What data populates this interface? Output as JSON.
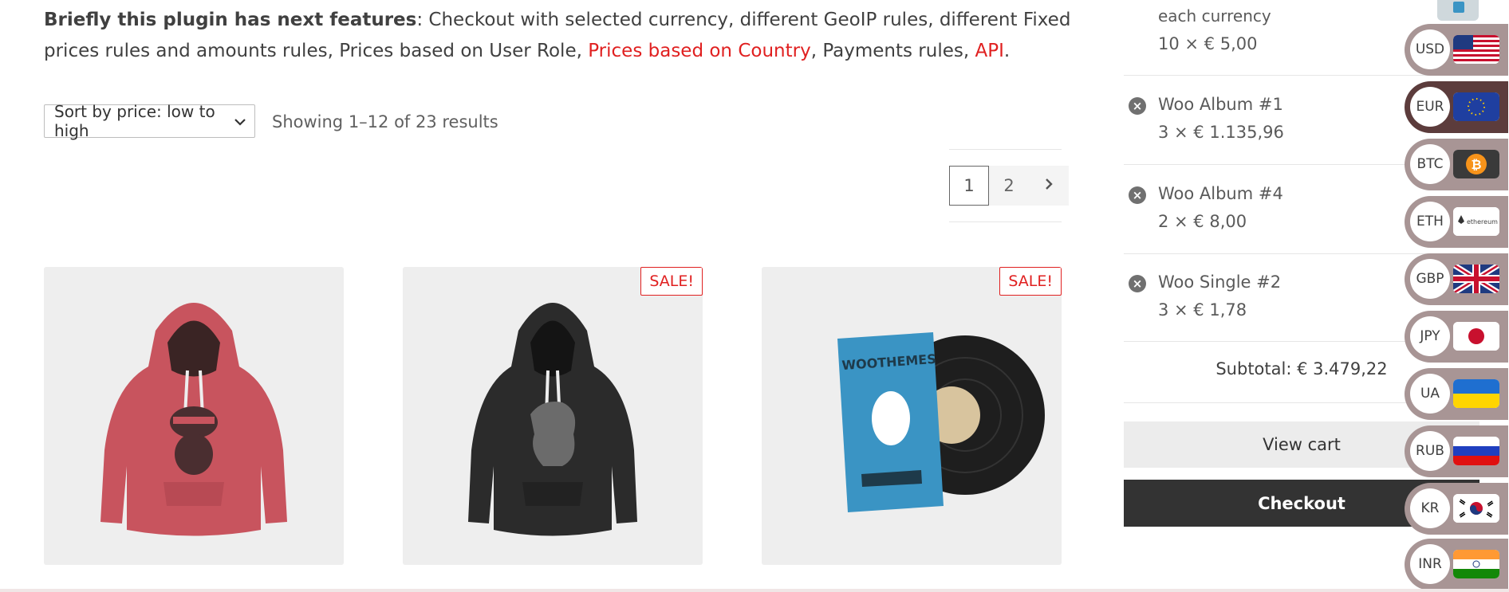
{
  "intro": {
    "lead": "Briefly this plugin has next features",
    "text1": ": Checkout with selected currency, different GeoIP rules, different Fixed prices rules and amounts rules, Prices based on User Role, ",
    "link1": "Prices based on Country",
    "text2": ", Payments rules, ",
    "link2": "API",
    "text3": "."
  },
  "shop": {
    "sort_label": "Sort by price: low to high",
    "result_count": "Showing 1–12 of 23 results",
    "pages": [
      "1",
      "2"
    ],
    "next_icon": "chevron-right-icon",
    "products": [
      {
        "name": "ninja-hoodie",
        "sale": ""
      },
      {
        "name": "black-hoodie",
        "sale": "SALE!"
      },
      {
        "name": "vinyl-album",
        "sale": "SALE!"
      }
    ]
  },
  "cart": {
    "partial_line1": "each currency",
    "partial_line2": "10 × € 5,00",
    "items": [
      {
        "name": "Woo Album #1",
        "qty": "3 × € 1.135,96"
      },
      {
        "name": "Woo Album #4",
        "qty": "2 × € 8,00"
      },
      {
        "name": "Woo Single #2",
        "qty": "3 × € 1,78"
      }
    ],
    "subtotal": "Subtotal: € 3.479,22",
    "view_cart": "View cart",
    "checkout": "Checkout"
  },
  "currencies": [
    {
      "code": "USD",
      "flag": "us-flag"
    },
    {
      "code": "EUR",
      "flag": "eu-flag",
      "active": true
    },
    {
      "code": "BTC",
      "flag": "btc-flag"
    },
    {
      "code": "ETH",
      "flag": "eth-flag",
      "flag_text": "ethereum"
    },
    {
      "code": "GBP",
      "flag": "gb-flag"
    },
    {
      "code": "JPY",
      "flag": "jp-flag"
    },
    {
      "code": "UA",
      "flag": "ua-flag"
    },
    {
      "code": "RUB",
      "flag": "ru-flag"
    },
    {
      "code": "KR",
      "flag": "kr-flag"
    },
    {
      "code": "INR",
      "flag": "in-flag"
    }
  ],
  "colors": {
    "accent_red": "#e02020",
    "switcher_idle": "#a89595",
    "switcher_active": "#5c3c3c",
    "checkout_bg": "#333333"
  },
  "album": {
    "brand": "WOOTHEMES"
  }
}
